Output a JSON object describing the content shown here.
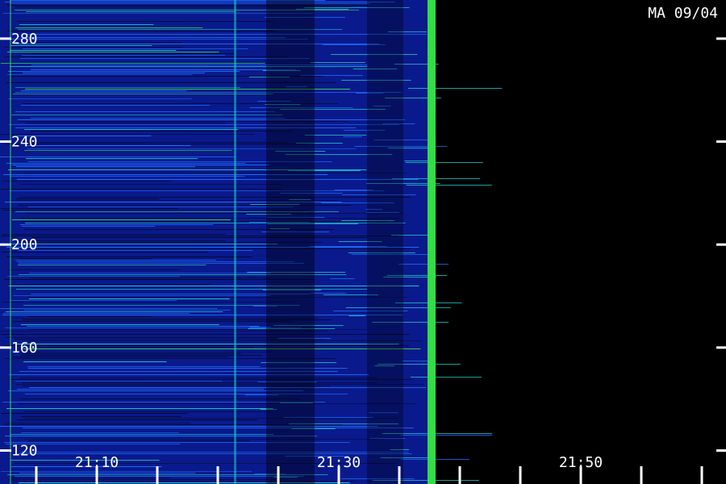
{
  "chart_data": {
    "type": "heatmap",
    "station_label": "MA 09/04",
    "y_ticks": [
      {
        "value": 280,
        "label": "280"
      },
      {
        "value": 240,
        "label": "240"
      },
      {
        "value": 200,
        "label": "200"
      },
      {
        "value": 160,
        "label": "160"
      },
      {
        "value": 120,
        "label": "120"
      }
    ],
    "x_ticks": [
      {
        "value": "21:10",
        "label": "21:10"
      },
      {
        "value": "21:30",
        "label": "21:30"
      },
      {
        "value": "21:50",
        "label": "21:50"
      }
    ],
    "x_range": [
      "21:02",
      "21:62"
    ],
    "y_range": [
      107,
      295
    ],
    "data_end_time": "21:38",
    "minor_tick_interval_min": 5,
    "colors": {
      "background": "#000000",
      "low": "#0a1a8c",
      "mid": "#1e6cff",
      "high": "#1ec8c8",
      "peak": "#33dd44",
      "axis": "#ffffff"
    }
  }
}
